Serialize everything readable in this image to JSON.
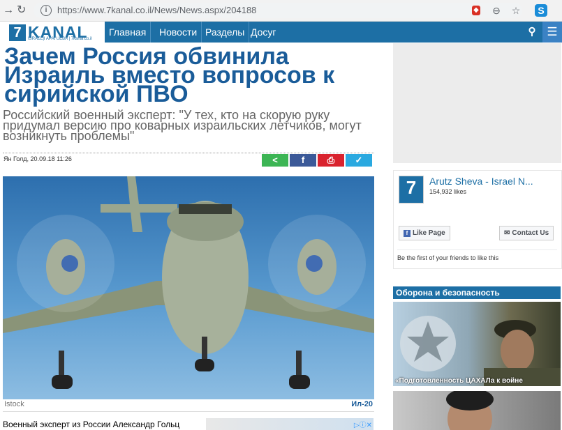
{
  "browser": {
    "url": "https://www.7kanal.co.il/News/News.aspx/204188",
    "back_icon": "arrow-right-icon",
    "reload_icon": "reload-icon"
  },
  "site": {
    "logo_mark": "7",
    "logo_text": "KANAL",
    "logo_tagline": "ISRAEL|I APAI UEBA | 7kanal.co.il",
    "nav": [
      "Главная",
      "Новости",
      "Разделы",
      "Досуг"
    ],
    "brand_color": "#1d6fa5"
  },
  "article": {
    "headline": "Зачем Россия обвинила Израиль вместо вопросов к сирийской ПВО",
    "subtitle": "Российский военный эксперт: \"У тех, кто на скорую руку придумал версию про коварных израильских летчиков, могут возникнуть проблемы\"",
    "byline": "Ян Голд, 20.09.18 11:26",
    "photo_source": "Istock",
    "photo_caption": "Ил-20",
    "body_start": "Военный эксперт из России Александр Гольц"
  },
  "share": {
    "share_color": "#3cb554",
    "facebook_color": "#3b5998",
    "print_color": "#d9232e",
    "twitter_color": "#2aa9e0"
  },
  "sidebar": {
    "fb_page_name": "Arutz Sheva - Israel N...",
    "fb_likes": "154,932 likes",
    "fb_like_label": "Like Page",
    "fb_contact_label": "Contact Us",
    "fb_friends_text": "Be the first of your friends to like this",
    "section_title": "Оборона и безопасность",
    "story_caption": "«Подготовленность ЦАХАЛа к войне"
  }
}
